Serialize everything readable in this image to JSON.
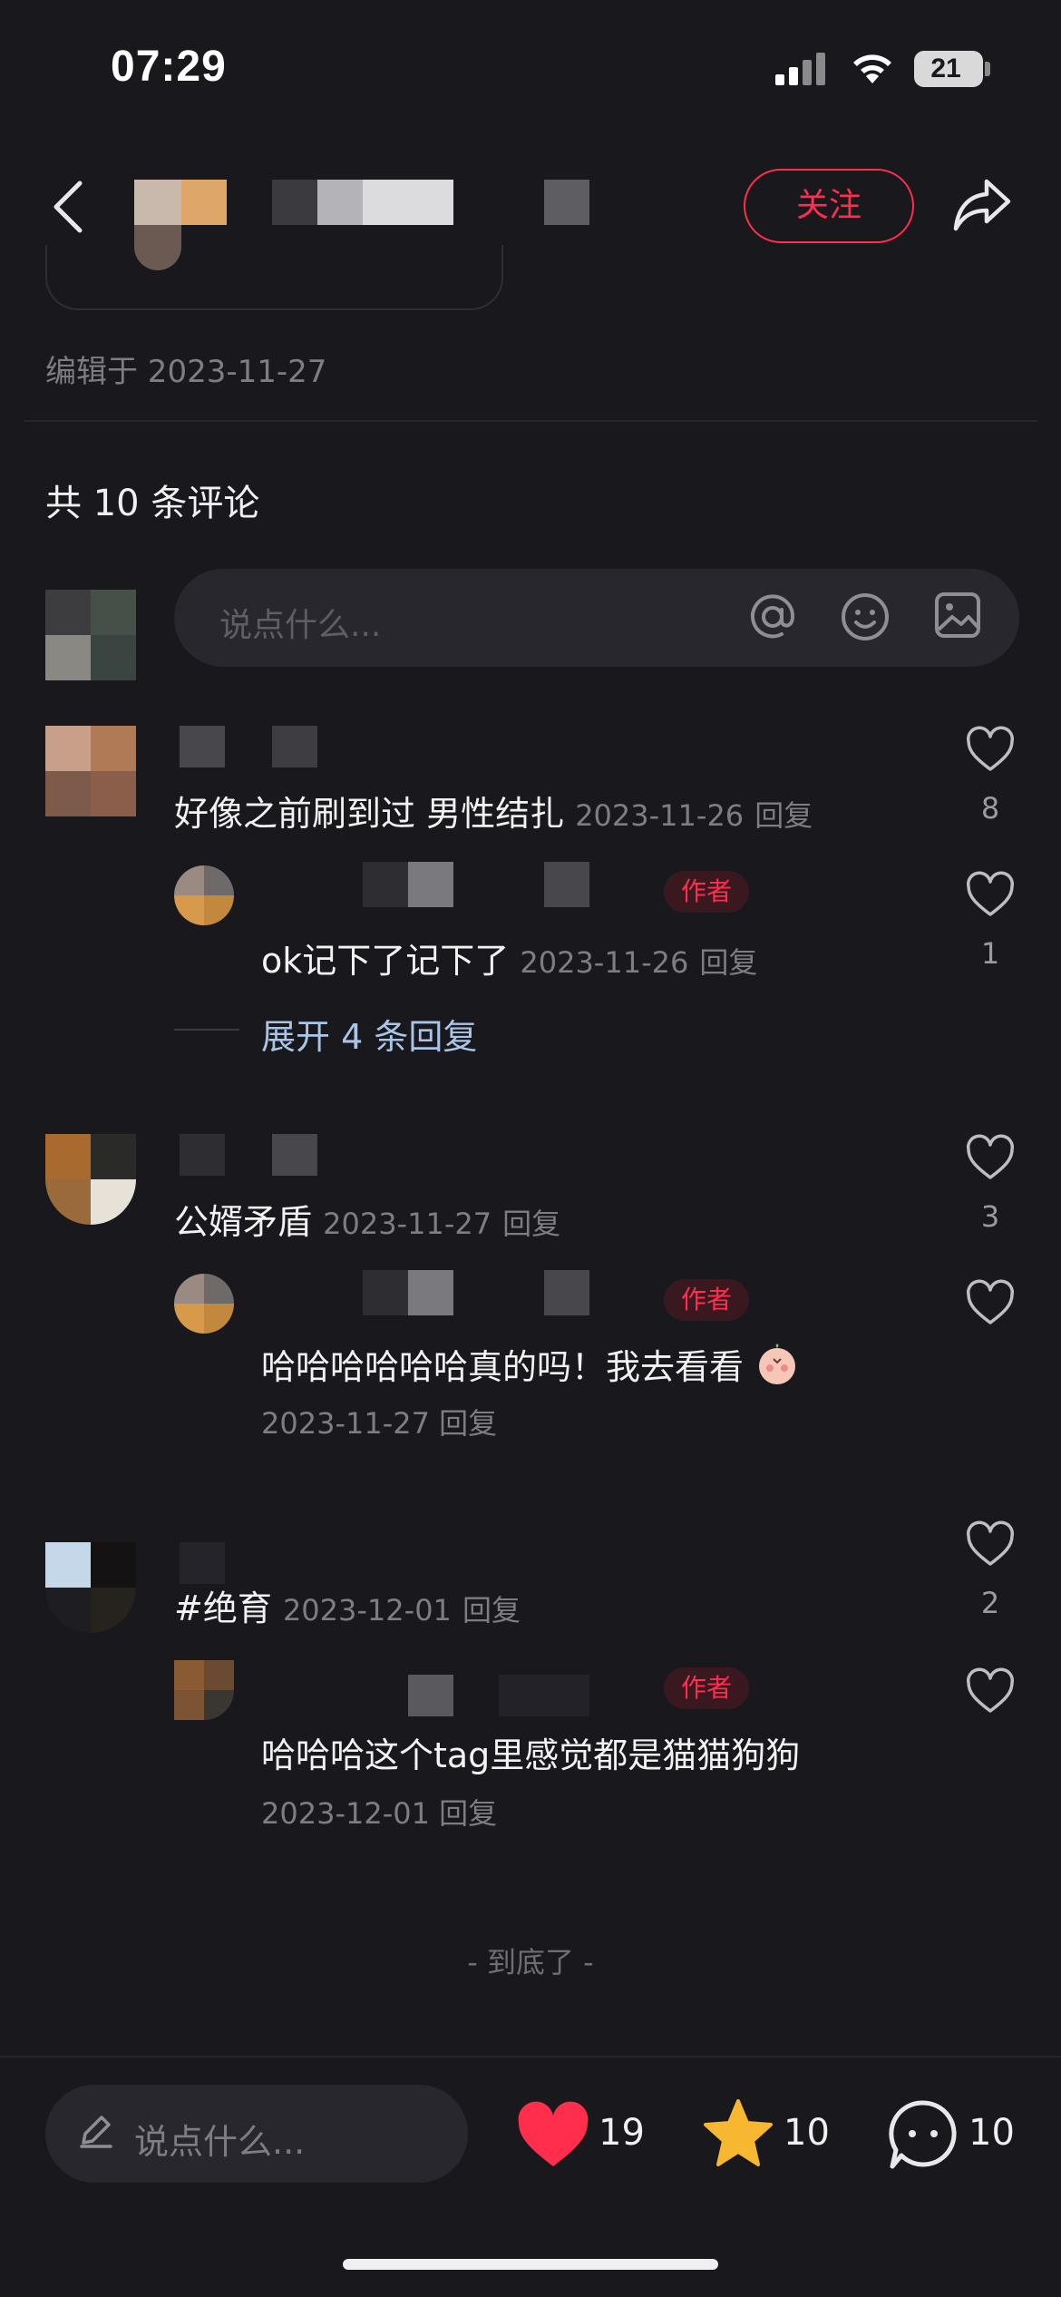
{
  "status_bar": {
    "time": "07:29",
    "battery": "21"
  },
  "header": {
    "follow_label": "关注"
  },
  "post": {
    "edited": "编辑于 2023-11-27"
  },
  "comments_section": {
    "count_label": "共 10 条评论",
    "input_placeholder": "说点什么..."
  },
  "comments": [
    {
      "text": "好像之前刷到过 男性结扎",
      "date": "2023-11-26",
      "reply_label": "回复",
      "likes": "8",
      "reply": {
        "badge": "作者",
        "text": "ok记下了记下了",
        "date": "2023-11-26",
        "reply_label": "回复",
        "likes": "1"
      },
      "expand_label": "展开 4 条回复"
    },
    {
      "text": "公婿矛盾",
      "date": "2023-11-27",
      "reply_label": "回复",
      "likes": "3",
      "reply": {
        "badge": "作者",
        "text": "哈哈哈哈哈哈真的吗！我去看看",
        "date": "2023-11-27",
        "reply_label": "回复",
        "likes": ""
      }
    },
    {
      "text": "#绝育",
      "date": "2023-12-01",
      "reply_label": "回复",
      "likes": "2",
      "reply": {
        "badge": "作者",
        "text": "哈哈哈这个tag里感觉都是猫猫狗狗",
        "date": "2023-12-01",
        "reply_label": "回复",
        "likes": ""
      }
    }
  ],
  "end_label": "- 到底了 -",
  "bottom_bar": {
    "input_placeholder": "说点什么...",
    "likes": "19",
    "favorites": "10",
    "comments": "10"
  },
  "colors": {
    "accent": "#ff2e4d",
    "background": "#18181d",
    "star": "#f7b731",
    "link": "#a9c4e6"
  },
  "icons": [
    "back-icon",
    "share-icon",
    "at-icon",
    "emoji-icon",
    "image-icon",
    "heart-outline-icon",
    "pencil-icon",
    "heart-filled-icon",
    "star-icon",
    "chat-icon"
  ]
}
